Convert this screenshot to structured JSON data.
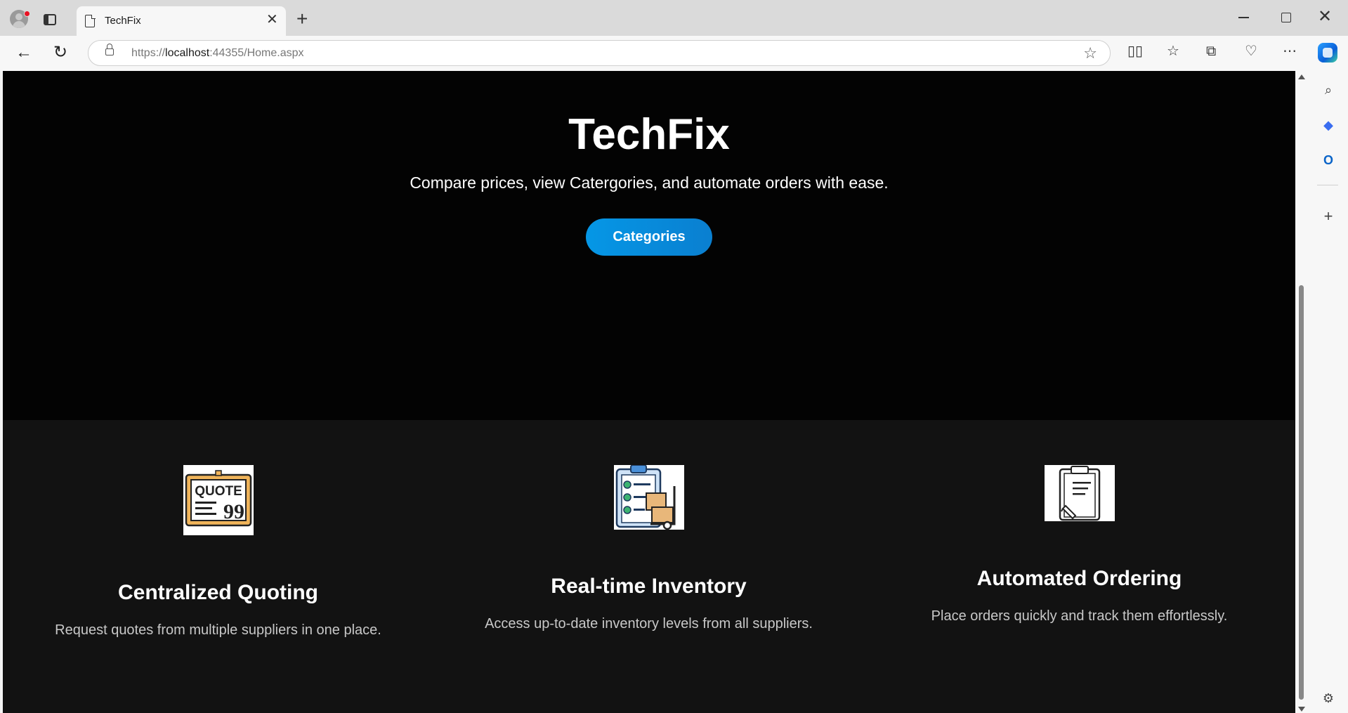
{
  "browser": {
    "tab_title": "TechFix",
    "tab_close_glyph": "✕",
    "new_tab_glyph": "+",
    "url_prefix": "https://",
    "url_host": "localhost",
    "url_rest": ":44355/Home.aspx",
    "icons": {
      "back": "back-arrow-icon",
      "refresh": "refresh-icon",
      "favorite": "star-icon",
      "split": "split-screen-icon",
      "favorites": "favorites-icon",
      "collections": "collections-icon",
      "health": "browser-essentials-icon",
      "more": "more-icon",
      "copilot": "copilot-icon"
    }
  },
  "sidebar": {
    "icons": [
      "search-icon",
      "copilot-apps-icon",
      "outlook-icon",
      "add-icon",
      "settings-icon"
    ]
  },
  "hero": {
    "title": "TechFix",
    "subtitle": "Compare prices, view Catergories, and automate orders with ease.",
    "button_label": "Categories"
  },
  "features": [
    {
      "icon": "quote-icon",
      "title": "Centralized Quoting",
      "description": "Request quotes from multiple suppliers in one place."
    },
    {
      "icon": "inventory-icon",
      "title": "Real-time Inventory",
      "description": "Access up-to-date inventory levels from all suppliers."
    },
    {
      "icon": "clipboard-icon",
      "title": "Automated Ordering",
      "description": "Place orders quickly and track them effortlessly."
    }
  ],
  "colors": {
    "hero_bg": "#030303",
    "features_bg": "#121212",
    "button": "#0597e6"
  }
}
